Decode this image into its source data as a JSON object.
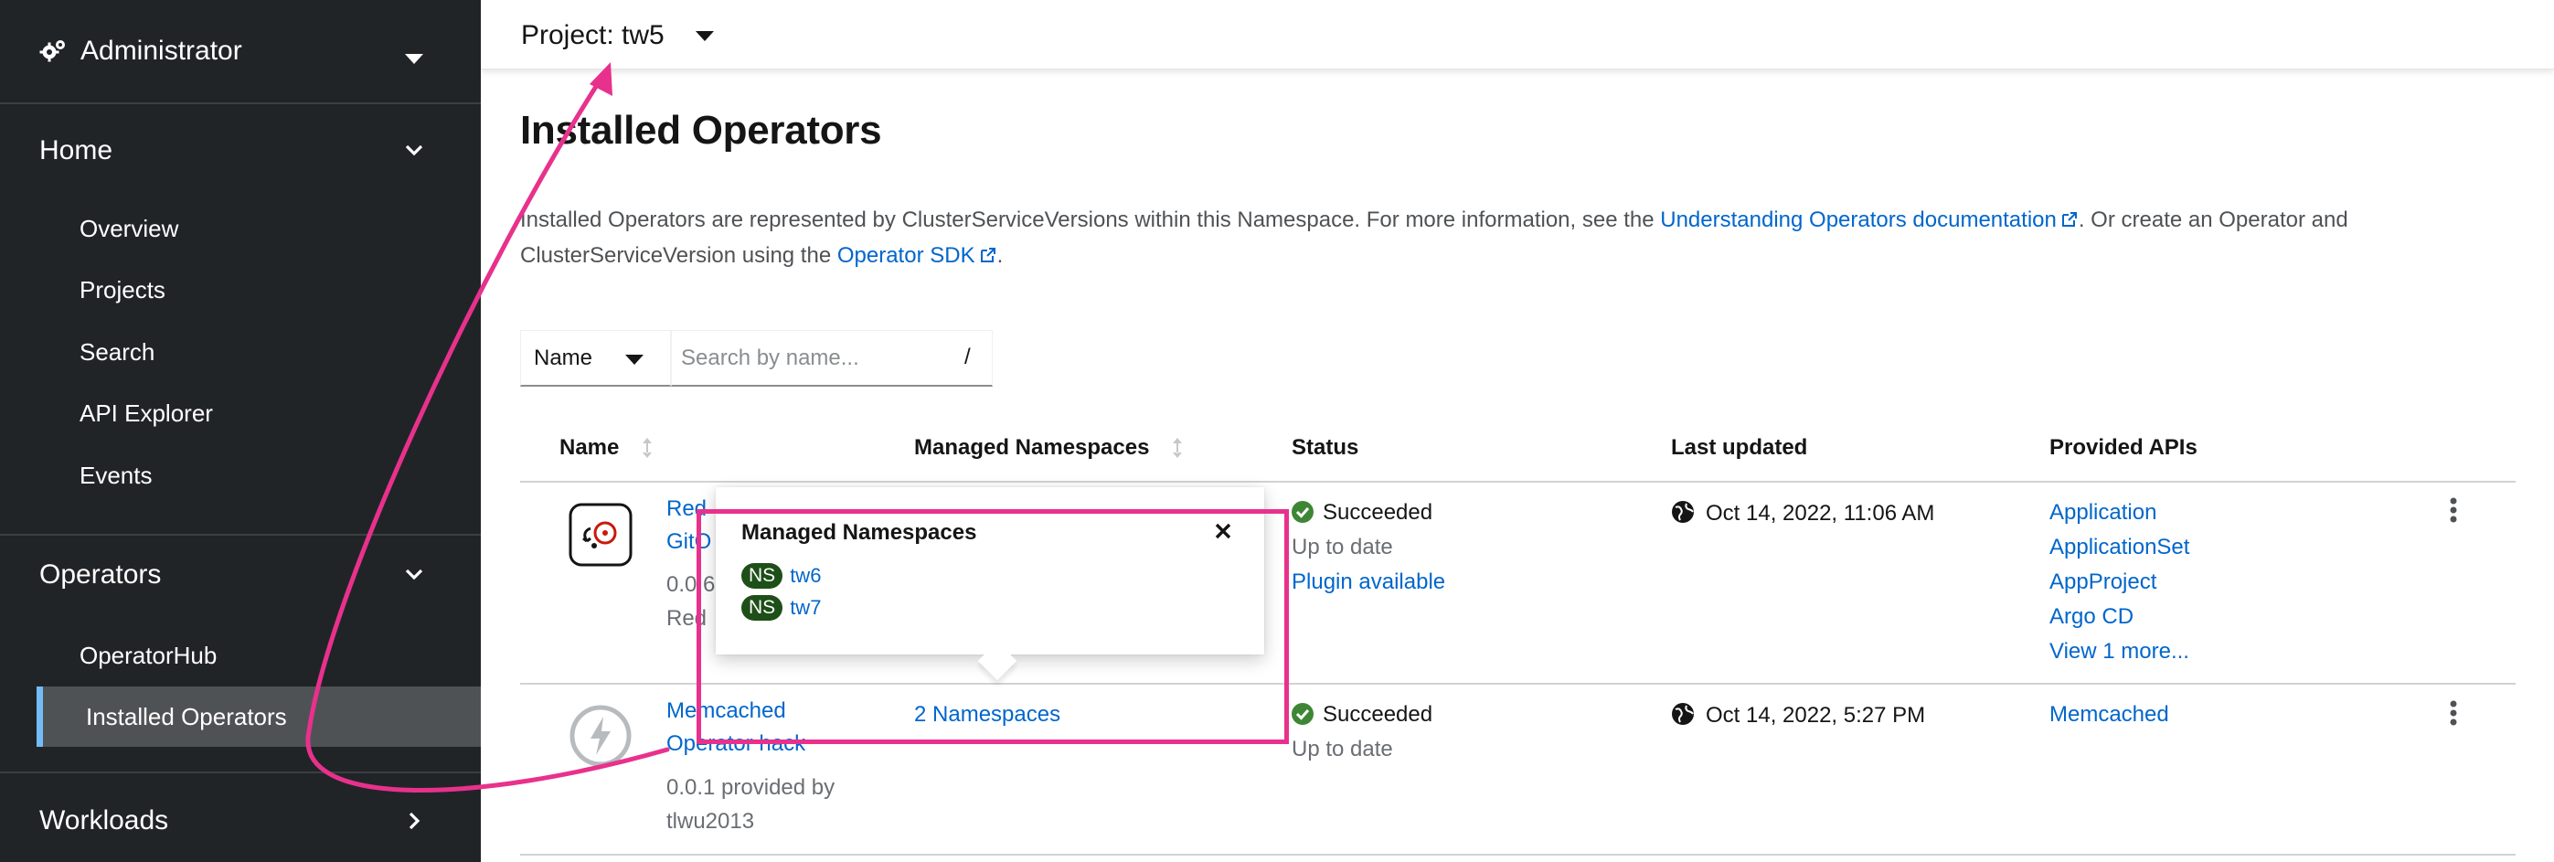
{
  "sidebar": {
    "perspective": "Administrator",
    "home": {
      "label": "Home",
      "items": [
        "Overview",
        "Projects",
        "Search",
        "API Explorer",
        "Events"
      ]
    },
    "operators": {
      "label": "Operators",
      "items": [
        "OperatorHub",
        "Installed Operators"
      ]
    },
    "workloads": {
      "label": "Workloads"
    }
  },
  "project_bar": {
    "label": "Project: tw5"
  },
  "page": {
    "title": "Installed Operators",
    "description": {
      "part1": "Installed Operators are represented by ClusterServiceVersions within this Namespace. For more information, see the ",
      "link1": "Understanding Operators documentation",
      "part2": ". Or create an Operator and ClusterServiceVersion using the ",
      "link2": "Operator SDK",
      "part3": "."
    }
  },
  "filter": {
    "type": "Name",
    "placeholder": "Search by name...",
    "shortcut": "/"
  },
  "table": {
    "columns": [
      "Name",
      "Managed Namespaces",
      "Status",
      "Last updated",
      "Provided APIs"
    ],
    "rows": [
      {
        "name_visible": "Red",
        "name_visible_2": "GitO",
        "version_visible": "0.0.6",
        "provider_visible": "Red",
        "status": "Succeeded",
        "status_detail": "Up to date",
        "status_link": "Plugin available",
        "last_updated": "Oct 14, 2022, 11:06 AM",
        "apis": [
          "Application",
          "ApplicationSet",
          "AppProject",
          "Argo CD",
          "View 1 more..."
        ]
      },
      {
        "name": "Memcached",
        "name_2": "Operator hack",
        "version": "0.0.1 provided by",
        "provider": "tlwu2013",
        "managed_namespaces": "2 Namespaces",
        "status": "Succeeded",
        "status_detail": "Up to date",
        "last_updated": "Oct 14, 2022, 5:27 PM",
        "apis": [
          "Memcached"
        ]
      }
    ]
  },
  "popover": {
    "title": "Managed Namespaces",
    "badge": "NS",
    "namespaces": [
      "tw6",
      "tw7"
    ]
  },
  "colors": {
    "sidebar_bg": "#212427",
    "link": "#0066cc",
    "success": "#3e8635",
    "ns_badge": "#1e4f18",
    "annotation": "#e8318c"
  }
}
